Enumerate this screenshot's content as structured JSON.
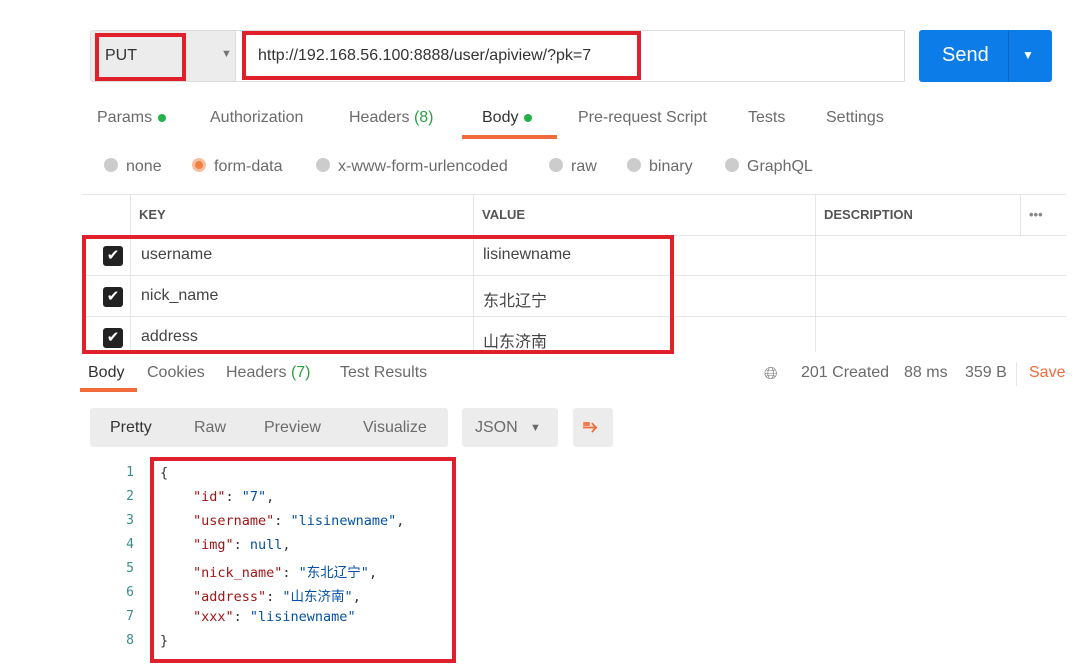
{
  "request": {
    "method": "PUT",
    "url": "http://192.168.56.100:8888/user/apiview/?pk=7",
    "send_label": "Send"
  },
  "tabs": [
    {
      "label": "Params",
      "dot": true
    },
    {
      "label": "Authorization"
    },
    {
      "label": "Headers",
      "count": "(8)"
    },
    {
      "label": "Body",
      "dot": true,
      "active": true
    },
    {
      "label": "Pre-request Script"
    },
    {
      "label": "Tests"
    },
    {
      "label": "Settings"
    }
  ],
  "body_types": [
    {
      "label": "none"
    },
    {
      "label": "form-data",
      "selected": true
    },
    {
      "label": "x-www-form-urlencoded"
    },
    {
      "label": "raw"
    },
    {
      "label": "binary"
    },
    {
      "label": "GraphQL"
    }
  ],
  "table": {
    "headers": [
      "KEY",
      "VALUE",
      "DESCRIPTION"
    ],
    "more": "•••",
    "rows": [
      {
        "checked": true,
        "key": "username",
        "value": "lisinewname"
      },
      {
        "checked": true,
        "key": "nick_name",
        "value": "东北辽宁"
      },
      {
        "checked": true,
        "key": "address",
        "value": "山东济南"
      }
    ]
  },
  "response": {
    "tabs": [
      {
        "label": "Body",
        "active": true
      },
      {
        "label": "Cookies"
      },
      {
        "label": "Headers",
        "count": "(7)"
      },
      {
        "label": "Test Results"
      }
    ],
    "status": "201 Created",
    "time": "88 ms",
    "size": "359 B",
    "save": "Save",
    "views": [
      "Pretty",
      "Raw",
      "Preview",
      "Visualize"
    ],
    "format": "JSON",
    "lines": [
      "1",
      "2",
      "3",
      "4",
      "5",
      "6",
      "7",
      "8"
    ],
    "json": [
      {
        "t": "{"
      },
      {
        "k": "\"id\"",
        "v": "\"7\"",
        "c": ","
      },
      {
        "k": "\"username\"",
        "v": "\"lisinewname\"",
        "c": ","
      },
      {
        "k": "\"img\"",
        "v": "null",
        "c": ","
      },
      {
        "k": "\"nick_name\"",
        "v": "\"东北辽宁\"",
        "c": ","
      },
      {
        "k": "\"address\"",
        "v": "\"山东济南\"",
        "c": ","
      },
      {
        "k": "\"xxx\"",
        "v": "\"lisinewname\"",
        "c": ""
      },
      {
        "t": "}"
      }
    ]
  },
  "colors": {
    "accent": "#f26b3a",
    "send": "#0b7ce8",
    "highlight": "#e0202a",
    "ok": "#2e9f47"
  }
}
